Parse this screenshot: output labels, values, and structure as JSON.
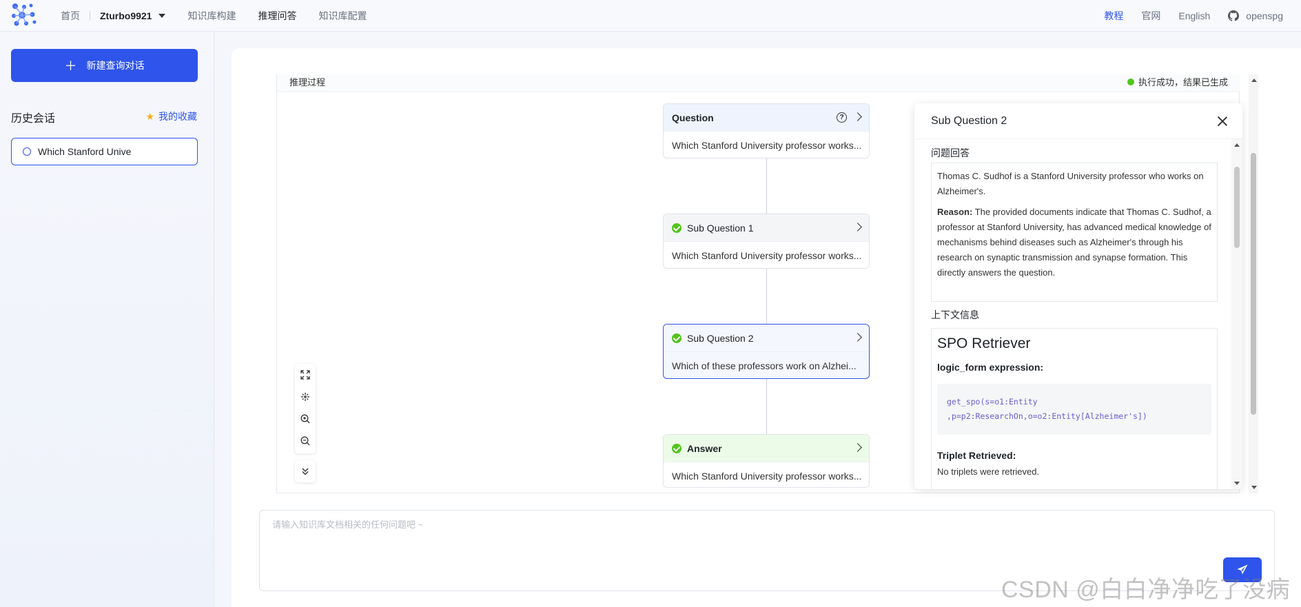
{
  "nav": {
    "home": "首页",
    "user": "Zturbo9921",
    "kb_build": "知识库构建",
    "reasoning_qa": "推理问答",
    "kb_config": "知识库配置",
    "tutorial": "教程",
    "official": "官网",
    "language": "English",
    "github": "openspg"
  },
  "sidebar": {
    "new_chat": "新建查询对话",
    "history_title": "历史会话",
    "favorites": "我的收藏",
    "history_items": [
      {
        "label": "Which Stanford Unive"
      }
    ]
  },
  "panel": {
    "head_left": "推理过程",
    "head_right": "执行成功，结果已生成"
  },
  "flow": {
    "question": {
      "title": "Question",
      "text": "Which Stanford University professor works..."
    },
    "sub1": {
      "title": "Sub Question 1",
      "text": "Which Stanford University professor works..."
    },
    "sub2": {
      "title": "Sub Question 2",
      "text": "Which of these professors work on Alzhei..."
    },
    "answer": {
      "title": "Answer",
      "text": "Which Stanford University professor works..."
    }
  },
  "detail": {
    "title": "Sub Question 2",
    "answer_label": "问题回答",
    "answer_text": "Thomas C. Sudhof is a Stanford University professor who works on Alzheimer's.",
    "reason_label": "Reason:",
    "reason_text": " The provided documents indicate that Thomas C. Sudhof, a professor at Stanford University, has advanced medical knowledge of mechanisms behind diseases such as Alzheimer's through his research on synaptic transmission and synapse formation. This directly answers the question.",
    "context_label": "上下文信息",
    "retriever_title": "SPO Retriever",
    "logic_form_label": "logic_form expression:",
    "code_line1": "get_spo(s=o1:Entity",
    "code_line2": ",p=p2:ResearchOn,o=o2:Entity[Alzheimer's])",
    "triplet_label": "Triplet Retrieved:",
    "triplet_text": "No triplets were retrieved."
  },
  "input": {
    "placeholder": "请输入知识库文档相关的任何问题吧 ~"
  },
  "watermark": "CSDN @白白净净吃了没病",
  "colors": {
    "primary": "#2f54eb",
    "success": "#52c41a",
    "star": "#faad14"
  },
  "icons": [
    "logo-icon",
    "caret-down-icon",
    "github-icon",
    "plus-icon",
    "star-icon",
    "chat-circle-icon",
    "help-icon",
    "chevron-right-icon",
    "check-circle-icon",
    "close-icon",
    "fullscreen-icon",
    "fit-view-icon",
    "zoom-in-icon",
    "zoom-out-icon",
    "double-chevron-down-icon",
    "send-icon"
  ]
}
